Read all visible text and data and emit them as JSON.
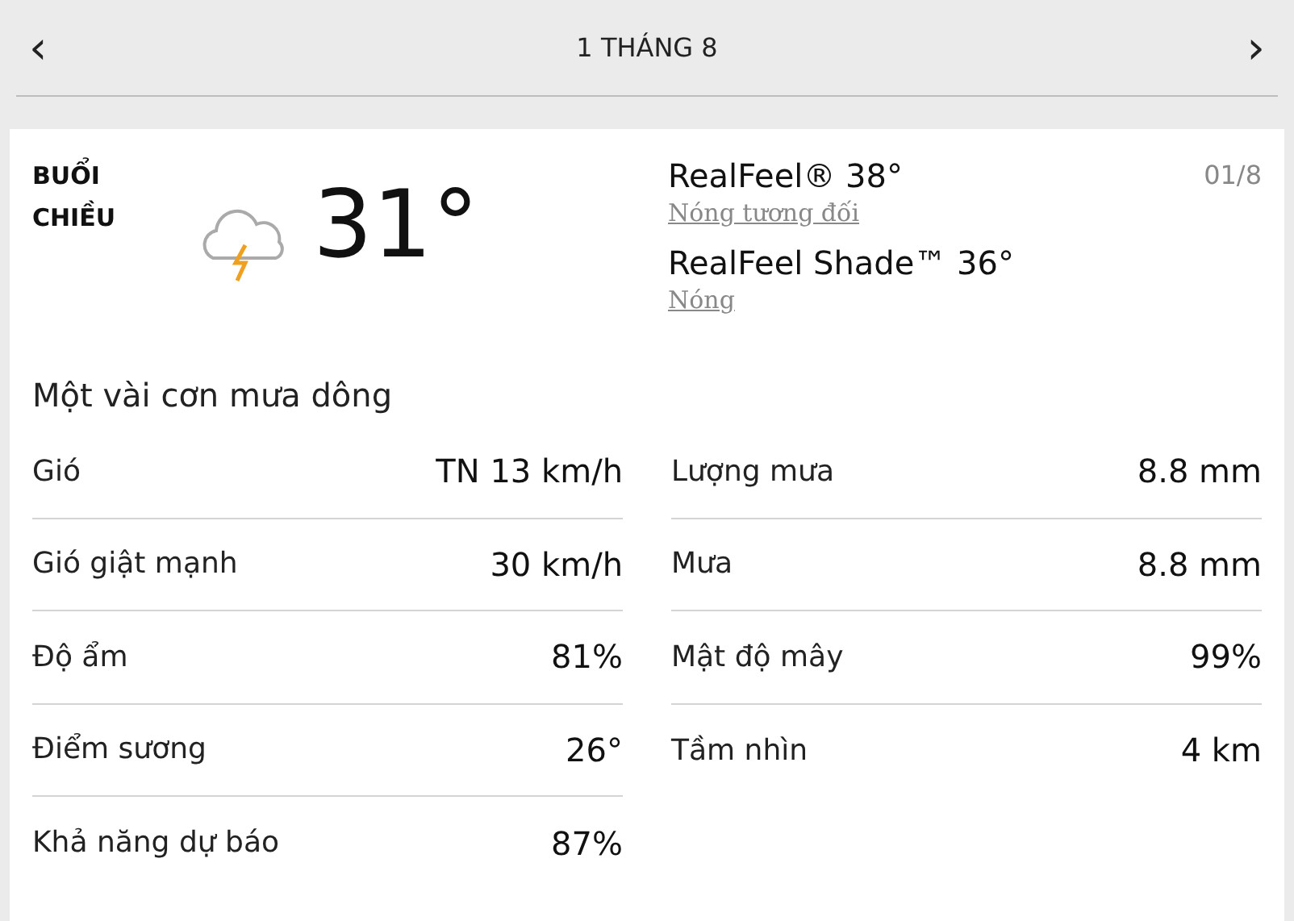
{
  "header": {
    "prev": "‹",
    "title": "1 THÁNG 8",
    "next": "›"
  },
  "period": {
    "label": "BUỔI CHIỀU",
    "temperature": "31°",
    "date": "01/8"
  },
  "realfeel": [
    {
      "label": "RealFeel® 38°",
      "description": "Nóng tương đối"
    },
    {
      "label": "RealFeel Shade™ 36°",
      "description": "Nóng"
    }
  ],
  "condition": "Một vài cơn mưa dông",
  "details_left": [
    {
      "label": "Gió",
      "value": "TN 13 km/h"
    },
    {
      "label": "Gió giật mạnh",
      "value": "30 km/h"
    },
    {
      "label": "Độ ẩm",
      "value": "81%"
    },
    {
      "label": "Điểm sương",
      "value": "26°"
    },
    {
      "label": "Khả năng dự báo",
      "value": "87%"
    }
  ],
  "details_right": [
    {
      "label": "Lượng mưa",
      "value": "8.8 mm"
    },
    {
      "label": "Mưa",
      "value": "8.8 mm"
    },
    {
      "label": "Mật độ mây",
      "value": "99%"
    },
    {
      "label": "Tầm nhìn",
      "value": "4 km"
    }
  ]
}
